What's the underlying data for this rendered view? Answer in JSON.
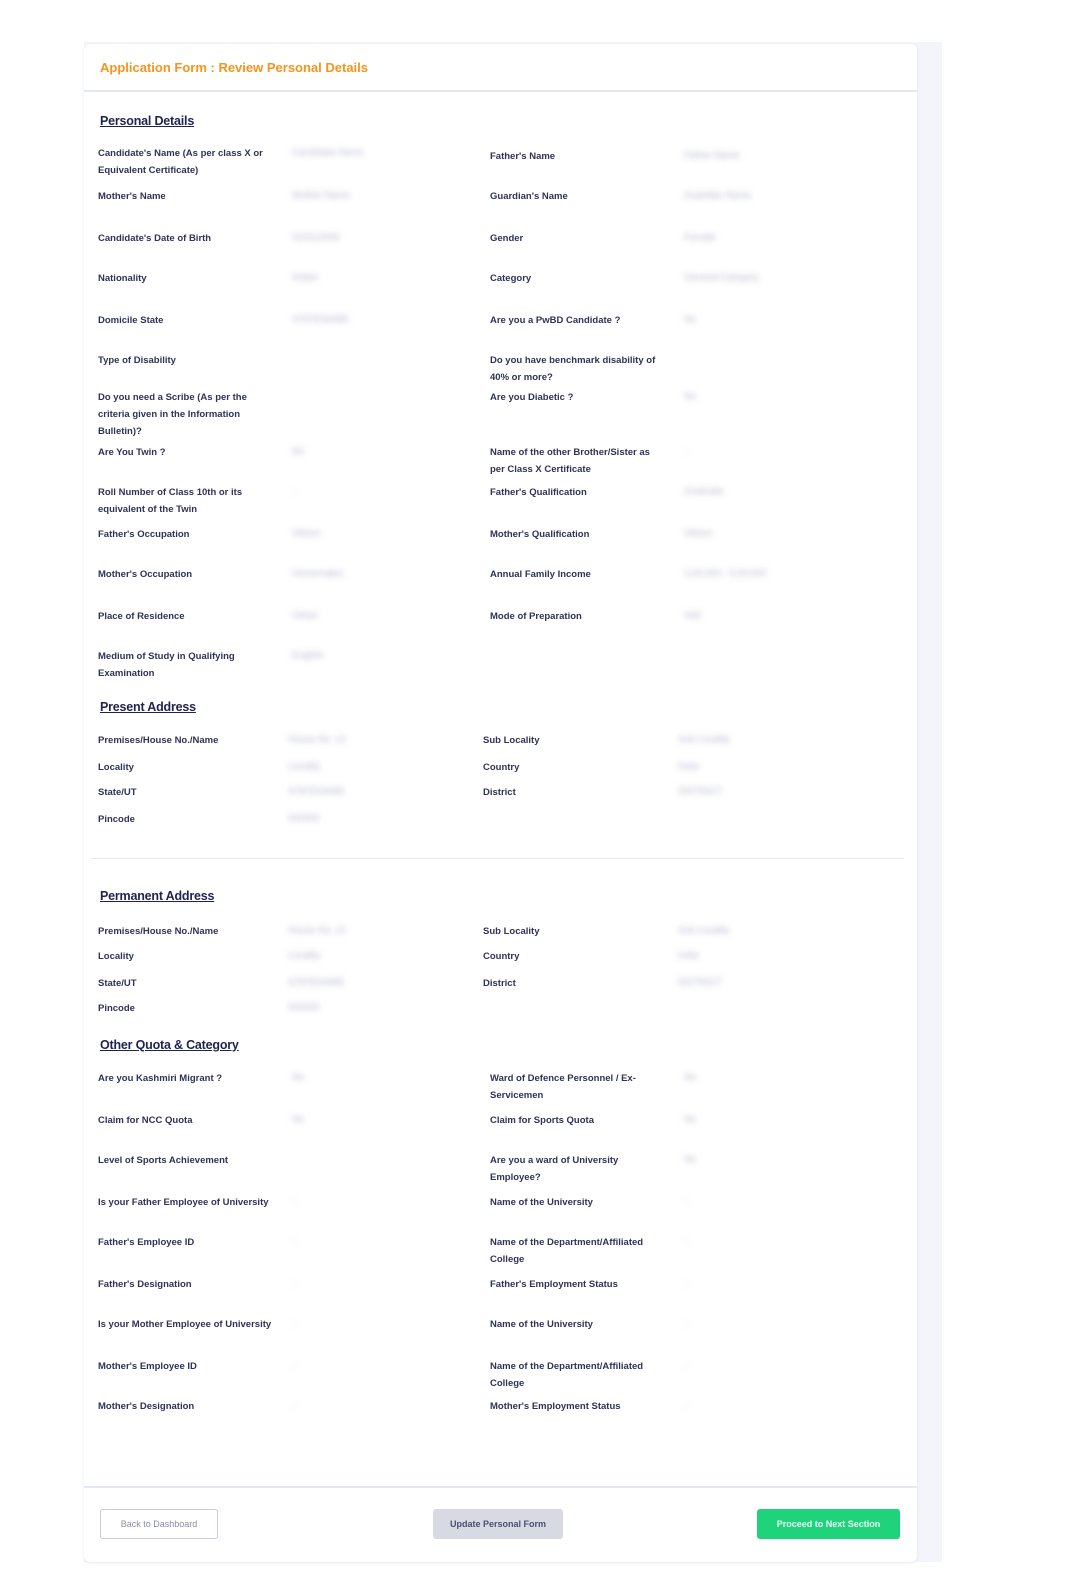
{
  "form": {
    "title": "Application Form : Review Personal Details"
  },
  "personal_details": {
    "heading": "Personal Details",
    "left": [
      {
        "label": "Candidate's Name (As per class X or Equivalent Certificate)",
        "value": "Candidate Name"
      },
      {
        "label": "Mother's Name",
        "value": "Mother Name"
      },
      {
        "label": "Candidate's Date of Birth",
        "value": "01/01/2005"
      },
      {
        "label": "Nationality",
        "value": "Indian"
      },
      {
        "label": "Domicile State",
        "value": "STATENAME"
      },
      {
        "label": "Type of Disability",
        "value": ""
      },
      {
        "label": "Do you need a Scribe (As per the criteria given in the Information Bulletin)?",
        "value": ""
      },
      {
        "label": "Are You Twin ?",
        "value": "No"
      },
      {
        "label": "Roll Number of Class 10th or its equivalent of the Twin",
        "value": "-"
      },
      {
        "label": "Father's Occupation",
        "value": "Others"
      },
      {
        "label": "Mother's Occupation",
        "value": "Homemaker"
      },
      {
        "label": "Place of Residence",
        "value": "Urban"
      },
      {
        "label": "Medium of Study in Qualifying Examination",
        "value": "English"
      }
    ],
    "right": [
      {
        "label": "Father's Name",
        "value": "Father Name"
      },
      {
        "label": "Guardian's Name",
        "value": "Guardian Name"
      },
      {
        "label": "Gender",
        "value": "Female"
      },
      {
        "label": "Category",
        "value": "General Category"
      },
      {
        "label": "Are you a PwBD Candidate ?",
        "value": "No"
      },
      {
        "label": "Do you have benchmark disability of 40% or more?",
        "value": ""
      },
      {
        "label": "Are you Diabetic ?",
        "value": "No"
      },
      {
        "label": "Name of the other Brother/Sister as per Class X Certificate",
        "value": "-"
      },
      {
        "label": "Father's Qualification",
        "value": "Graduate"
      },
      {
        "label": "Mother's Qualification",
        "value": "Others"
      },
      {
        "label": "Annual Family Income",
        "value": "1,00,000 - 5,00,000"
      },
      {
        "label": "Mode of Preparation",
        "value": "Self"
      }
    ]
  },
  "present_address": {
    "heading": "Present Address",
    "left": [
      {
        "label": "Premises/House No./Name",
        "value": "House No. 12"
      },
      {
        "label": "Locality",
        "value": "Locality"
      },
      {
        "label": "State/UT",
        "value": "STATENAME"
      },
      {
        "label": "Pincode",
        "value": "000000"
      }
    ],
    "right": [
      {
        "label": "Sub Locality",
        "value": "Sub Locality"
      },
      {
        "label": "Country",
        "value": "India"
      },
      {
        "label": "District",
        "value": "DISTRICT"
      }
    ]
  },
  "permanent_address": {
    "heading": "Permanent Address",
    "left": [
      {
        "label": "Premises/House No./Name",
        "value": "House No. 12"
      },
      {
        "label": "Locality",
        "value": "Locality"
      },
      {
        "label": "State/UT",
        "value": "STATENAME"
      },
      {
        "label": "Pincode",
        "value": "000000"
      }
    ],
    "right": [
      {
        "label": "Sub Locality",
        "value": "Sub Locality"
      },
      {
        "label": "Country",
        "value": "India"
      },
      {
        "label": "District",
        "value": "DISTRICT"
      }
    ]
  },
  "other_quota": {
    "heading": "Other Quota & Category",
    "left": [
      {
        "label": "Are you Kashmiri Migrant ?",
        "value": "No"
      },
      {
        "label": "Claim for NCC Quota",
        "value": "No"
      },
      {
        "label": "Level of Sports Achievement",
        "value": ""
      },
      {
        "label": "Is your Father Employee of University",
        "value": "-"
      },
      {
        "label": "Father's Employee ID",
        "value": "-"
      },
      {
        "label": "Father's Designation",
        "value": "-"
      },
      {
        "label": "Is your Mother Employee of University",
        "value": "-"
      },
      {
        "label": "Mother's Employee ID",
        "value": "-"
      },
      {
        "label": "Mother's Designation",
        "value": "-"
      }
    ],
    "right": [
      {
        "label": "Ward of Defence Personnel / Ex-Servicemen",
        "value": "No"
      },
      {
        "label": "Claim for Sports Quota",
        "value": "No"
      },
      {
        "label": "Are you a ward of University Employee?",
        "value": "No"
      },
      {
        "label": "Name of the University",
        "value": "-"
      },
      {
        "label": "Name of the Department/Affiliated College",
        "value": "-"
      },
      {
        "label": "Father's Employment Status",
        "value": "-"
      },
      {
        "label": "Name of the University",
        "value": "-"
      },
      {
        "label": "Name of the Department/Affiliated College",
        "value": "-"
      },
      {
        "label": "Mother's Employment Status",
        "value": "-"
      }
    ]
  },
  "buttons": {
    "back": "Back to Dashboard",
    "update": "Update Personal Form",
    "next": "Proceed to Next Section"
  }
}
